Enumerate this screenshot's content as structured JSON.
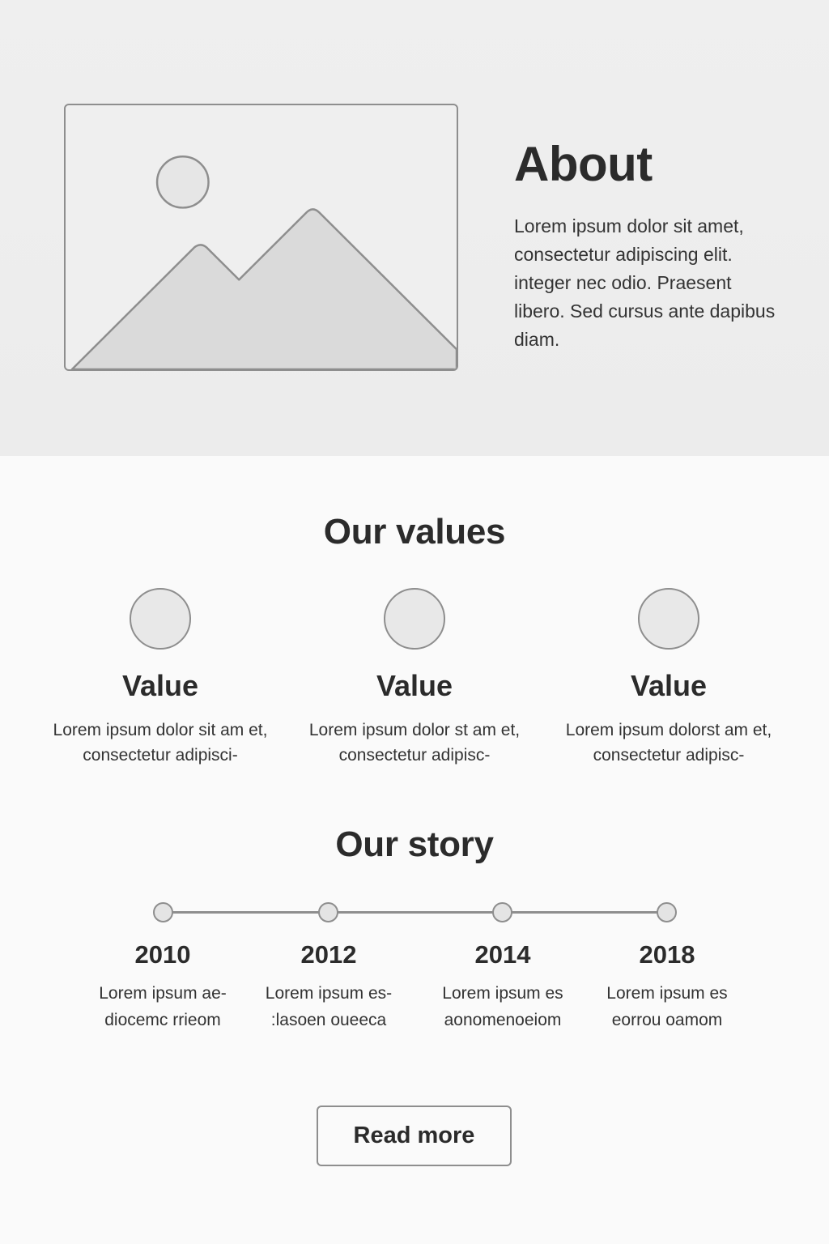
{
  "about": {
    "title": "About",
    "body": "Lorem ipsum dolor sit amet, consectetur adipiscing elit. integer nec odio. Praesent libero. Sed cursus ante dapibus diam.",
    "image_icon": "image-placeholder-icon"
  },
  "values": {
    "title": "Our values",
    "items": [
      {
        "heading": "Value",
        "text": "Lorem ipsum dolor sit am et, consectetur adipisci-"
      },
      {
        "heading": "Value",
        "text": "Lorem ipsum dolor st am et, consectetur adipisc-"
      },
      {
        "heading": "Value",
        "text": "Lorem ipsum dolorst am et, consectetur adipisc-"
      }
    ]
  },
  "story": {
    "title": "Our story",
    "milestones": [
      {
        "year": "2010",
        "text": "Lorem ipsum ae- diocemc rrieom"
      },
      {
        "year": "2012",
        "text": "Lorem ipsum es- :lasoen oueeca"
      },
      {
        "year": "2014",
        "text": "Lorem ipsum es aonomenoeiom"
      },
      {
        "year": "2018",
        "text": "Lorem ipsum es eorrou oamom"
      }
    ]
  },
  "cta": {
    "label": "Read more"
  },
  "colors": {
    "hero_bg": "#eeeeee",
    "page_bg": "#fafafa",
    "outline": "#8e8e8e",
    "text": "#2b2b2b"
  }
}
